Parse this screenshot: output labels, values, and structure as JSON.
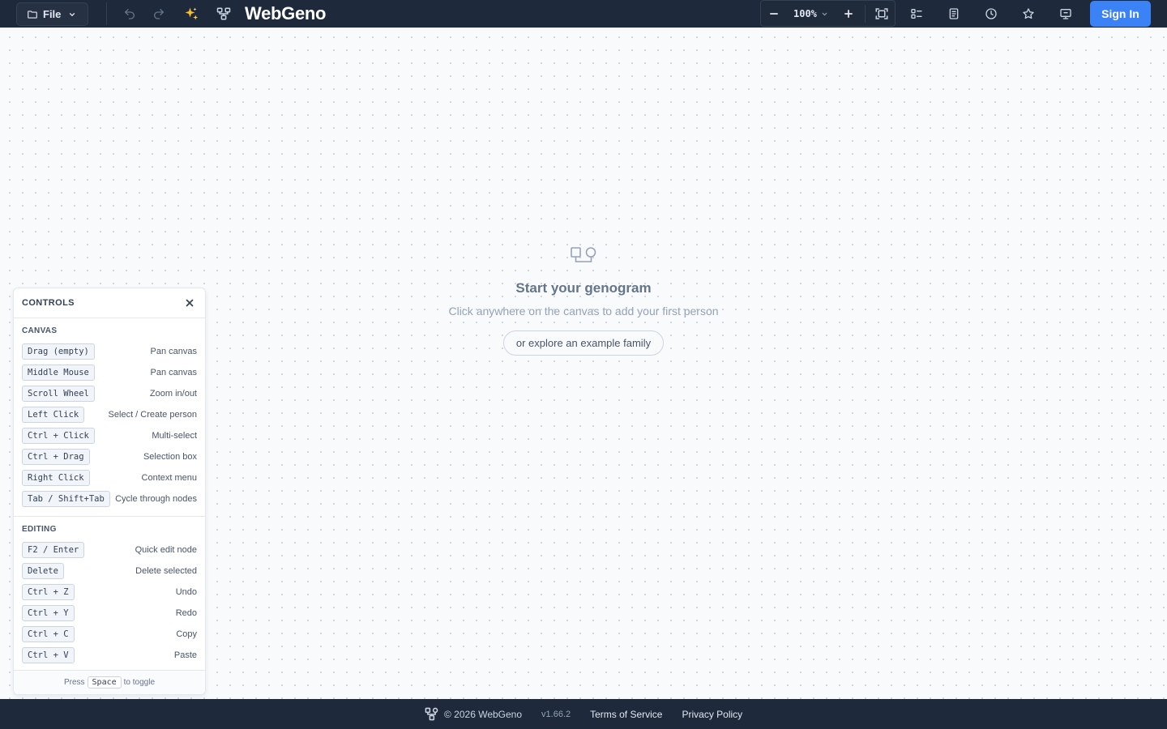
{
  "header": {
    "file_label": "File",
    "brand": "WebGeno",
    "zoom_level": "100%",
    "sign_in_label": "Sign In",
    "icons": [
      "folder-icon",
      "chevron-down-icon",
      "undo-icon",
      "redo-icon",
      "sparkles-icon",
      "tree-layout-icon",
      "zoom-out-icon",
      "zoom-in-icon",
      "fit-screen-icon",
      "checklist-icon",
      "document-icon",
      "history-icon",
      "star-icon",
      "feedback-icon"
    ],
    "accent_color": "#3b82f6"
  },
  "empty_state": {
    "title": "Start your genogram",
    "subtitle": "Click anywhere on the canvas to add your first person",
    "example_button": "or explore an example family"
  },
  "controls": {
    "title": "CONTROLS",
    "canvas_section": {
      "title": "CANVAS",
      "rows": [
        {
          "key": "Drag (empty)",
          "action": "Pan canvas"
        },
        {
          "key": "Middle Mouse",
          "action": "Pan canvas"
        },
        {
          "key": "Scroll Wheel",
          "action": "Zoom in/out"
        },
        {
          "key": "Left Click",
          "action": "Select / Create person"
        },
        {
          "key": "Ctrl + Click",
          "action": "Multi-select"
        },
        {
          "key": "Ctrl + Drag",
          "action": "Selection box"
        },
        {
          "key": "Right Click",
          "action": "Context menu"
        },
        {
          "key": "Tab / Shift+Tab",
          "action": "Cycle through nodes"
        }
      ]
    },
    "editing_section": {
      "title": "EDITING",
      "rows": [
        {
          "key": "F2 / Enter",
          "action": "Quick edit node"
        },
        {
          "key": "Delete",
          "action": "Delete selected"
        },
        {
          "key": "Ctrl + Z",
          "action": "Undo"
        },
        {
          "key": "Ctrl + Y",
          "action": "Redo"
        },
        {
          "key": "Ctrl + C",
          "action": "Copy"
        },
        {
          "key": "Ctrl + V",
          "action": "Paste"
        }
      ]
    },
    "footer": {
      "press": "Press",
      "key": "Space",
      "toggle": "to toggle"
    }
  },
  "footer": {
    "copyright": "© 2026 WebGeno",
    "version": "v1.66.2",
    "terms": "Terms of Service",
    "privacy": "Privacy Policy"
  }
}
